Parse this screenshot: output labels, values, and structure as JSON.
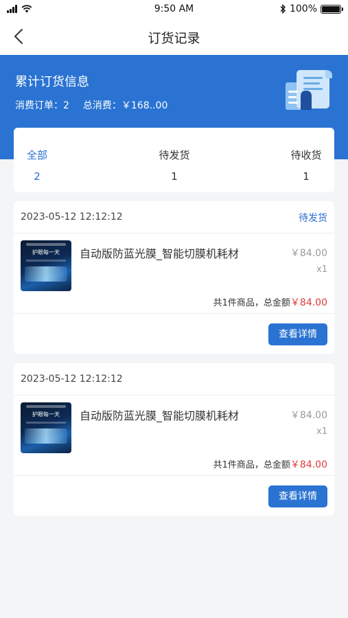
{
  "status_bar": {
    "time": "9:50 AM",
    "battery": "100%",
    "icons": [
      "signal-icon",
      "wifi-icon",
      "bluetooth-icon",
      "battery-icon"
    ]
  },
  "nav": {
    "back_icon": "chevron-left-icon",
    "title": "订货记录"
  },
  "banner": {
    "title": "累计订货信息",
    "orders_label": "消费订单：2",
    "total_label": "总消费：￥168..00",
    "illustration_icon": "document-stack-icon",
    "color": "#2a73d2"
  },
  "summary_tabs": [
    {
      "label": "全部",
      "count": "2",
      "active": true
    },
    {
      "label": "待发货",
      "count": "1",
      "active": false
    },
    {
      "label": "待收货",
      "count": "1",
      "active": false
    }
  ],
  "orders": [
    {
      "time": "2023-05-12 12:12:12",
      "status": "待发货",
      "product_name": "自动版防蓝光膜_智能切膜机耗材",
      "thumb_caption": "护眼每一天",
      "price": "￥84.00",
      "quantity": "x1",
      "total_text": "共1件商品，总金额",
      "total_amount": "￥84.00",
      "detail_button": "查看详情"
    },
    {
      "time": "2023-05-12 12:12:12",
      "status": "",
      "product_name": "自动版防蓝光膜_智能切膜机耗材",
      "thumb_caption": "护眼每一天",
      "price": "￥84.00",
      "quantity": "x1",
      "total_text": "共1件商品，总金额",
      "total_amount": "￥84.00",
      "detail_button": "查看详情"
    }
  ],
  "colors": {
    "accent": "#2a73d2",
    "price_red": "#e03a3a",
    "background": "#f4f5f7"
  }
}
